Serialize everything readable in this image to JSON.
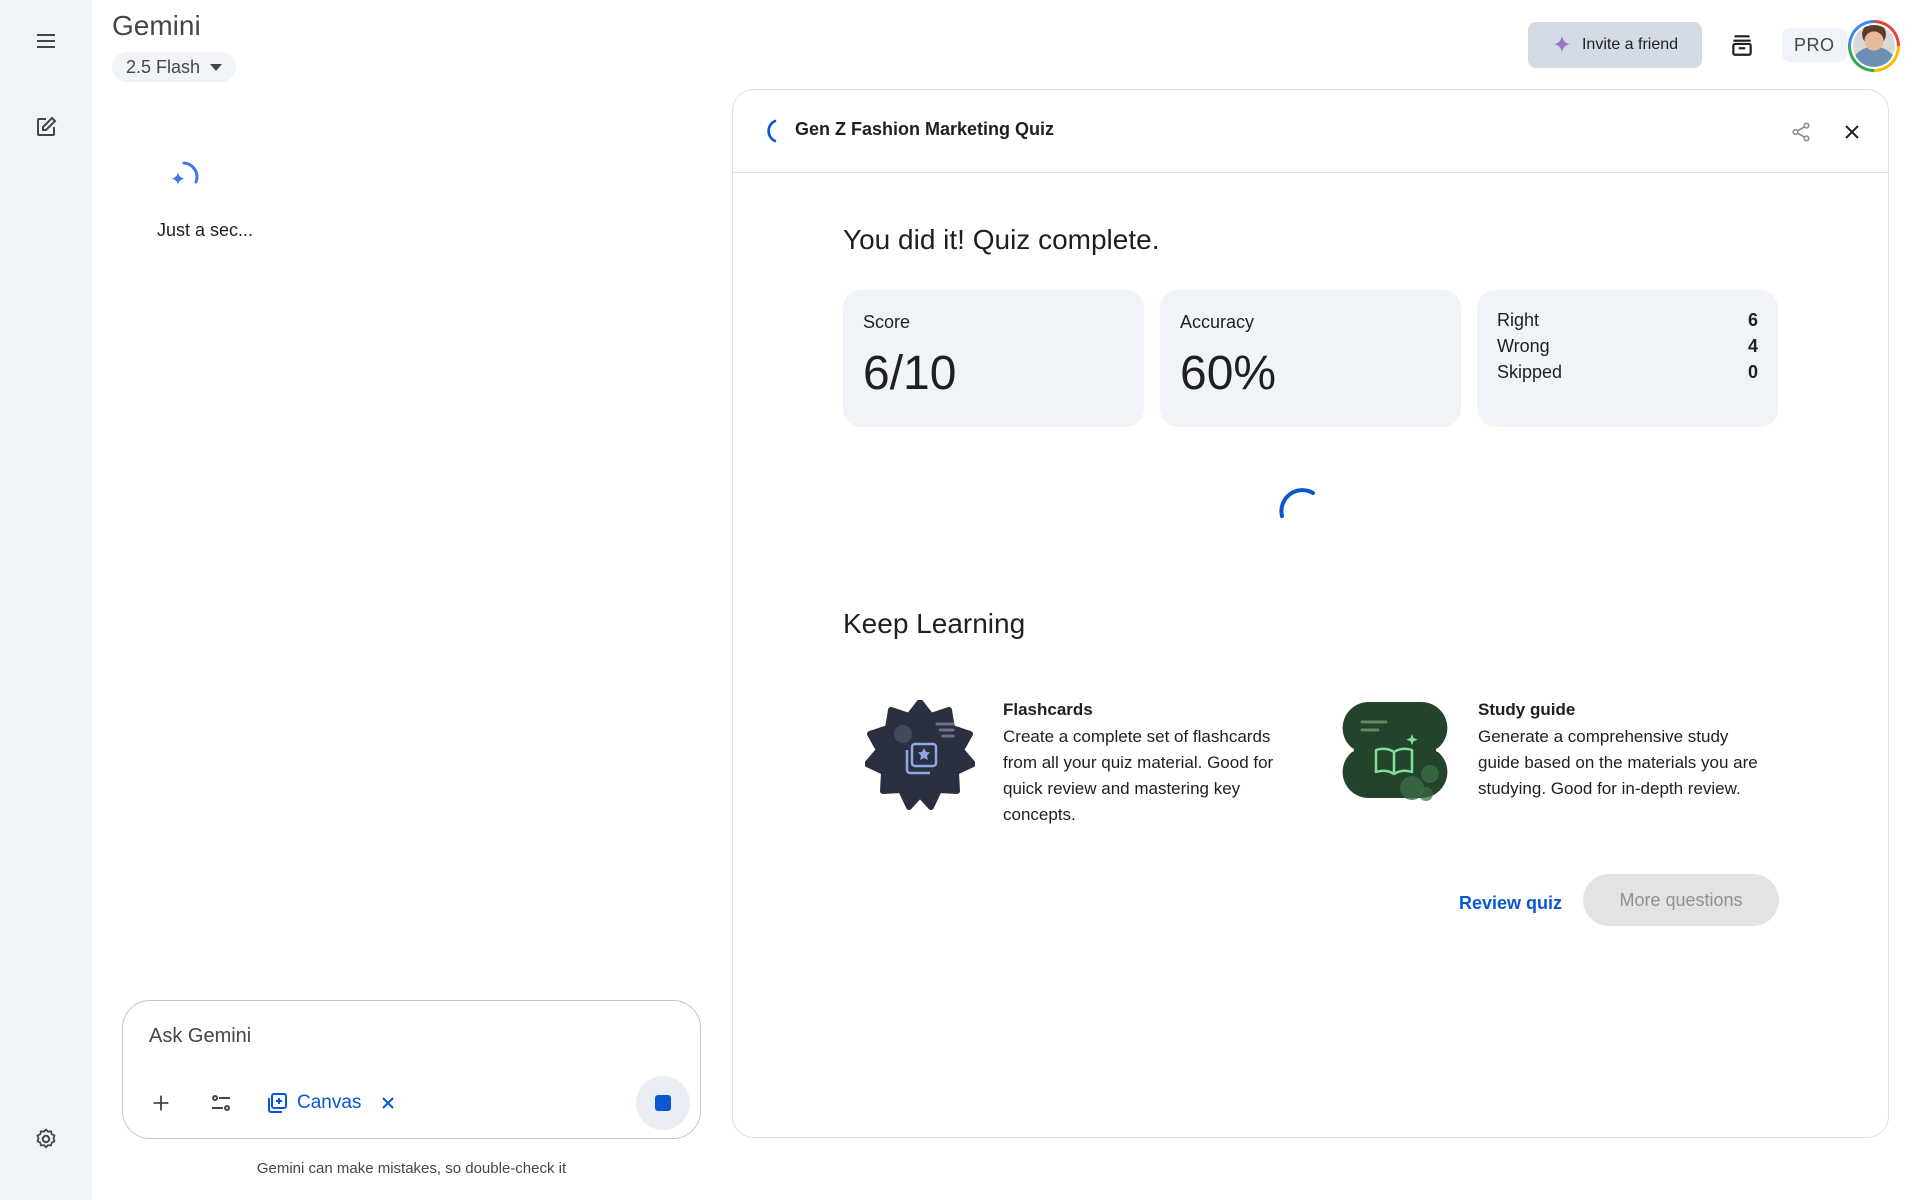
{
  "app": {
    "title": "Gemini",
    "model_label": "2.5 Flash"
  },
  "header": {
    "invite_label": "Invite a friend",
    "pro_label": "PRO"
  },
  "chat": {
    "loading_text": "Just a sec...",
    "input_placeholder": "Ask Gemini",
    "canvas_chip_label": "Canvas",
    "disclaimer": "Gemini can make mistakes, so double-check it"
  },
  "panel": {
    "title": "Gen Z Fashion Marketing Quiz",
    "heading": "You did it! Quiz complete.",
    "score": {
      "label": "Score",
      "value": "6/10"
    },
    "accuracy": {
      "label": "Accuracy",
      "value": "60%"
    },
    "breakdown": [
      {
        "label": "Right",
        "value": "6"
      },
      {
        "label": "Wrong",
        "value": "4"
      },
      {
        "label": "Skipped",
        "value": "0"
      }
    ],
    "keep_learning_heading": "Keep Learning",
    "learning_items": [
      {
        "title": "Flashcards",
        "description": "Create a complete set of flashcards from all your quiz material. Good for quick review and mastering key concepts."
      },
      {
        "title": "Study guide",
        "description": "Generate a comprehensive study guide based on the materials you are studying. Good for in-depth review."
      }
    ],
    "review_label": "Review quiz",
    "more_label": "More questions"
  },
  "colors": {
    "accent_blue": "#0b57d0",
    "rail_bg": "#f0f4f9",
    "card_bg": "#f0f4f9",
    "flashcard_icon_bg": "#2b3040",
    "study_icon_bg": "#24432b"
  },
  "icons": [
    "menu-icon",
    "new-chat-icon",
    "settings-icon",
    "sparkle-icon",
    "archive-icon",
    "share-icon",
    "close-icon",
    "plus-icon",
    "tools-icon",
    "canvas-icon",
    "stop-icon",
    "flashcards-icon",
    "study-guide-icon"
  ]
}
